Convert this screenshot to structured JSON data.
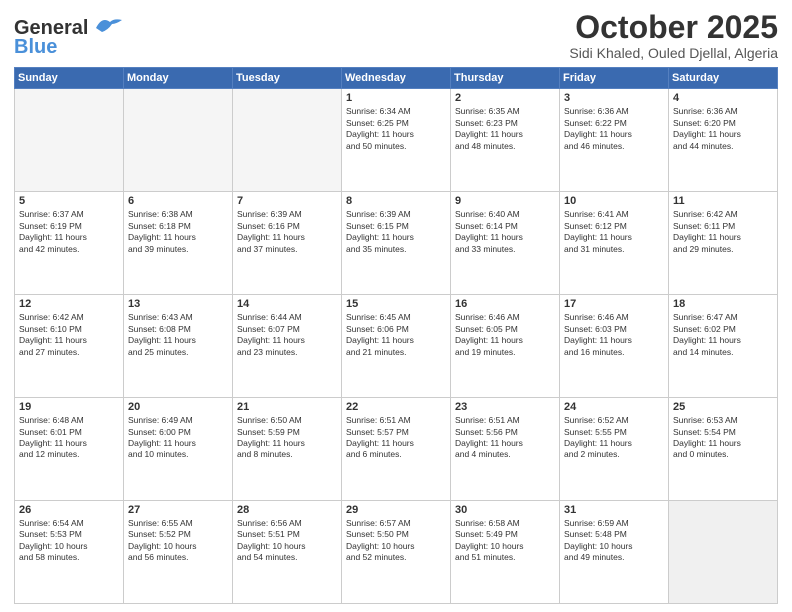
{
  "header": {
    "logo_general": "General",
    "logo_blue": "Blue",
    "month": "October 2025",
    "location": "Sidi Khaled, Ouled Djellal, Algeria"
  },
  "weekdays": [
    "Sunday",
    "Monday",
    "Tuesday",
    "Wednesday",
    "Thursday",
    "Friday",
    "Saturday"
  ],
  "days": [
    {
      "num": "",
      "info": "",
      "empty": true
    },
    {
      "num": "",
      "info": "",
      "empty": true
    },
    {
      "num": "",
      "info": "",
      "empty": true
    },
    {
      "num": "1",
      "info": "Sunrise: 6:34 AM\nSunset: 6:25 PM\nDaylight: 11 hours\nand 50 minutes."
    },
    {
      "num": "2",
      "info": "Sunrise: 6:35 AM\nSunset: 6:23 PM\nDaylight: 11 hours\nand 48 minutes."
    },
    {
      "num": "3",
      "info": "Sunrise: 6:36 AM\nSunset: 6:22 PM\nDaylight: 11 hours\nand 46 minutes."
    },
    {
      "num": "4",
      "info": "Sunrise: 6:36 AM\nSunset: 6:20 PM\nDaylight: 11 hours\nand 44 minutes."
    },
    {
      "num": "5",
      "info": "Sunrise: 6:37 AM\nSunset: 6:19 PM\nDaylight: 11 hours\nand 42 minutes."
    },
    {
      "num": "6",
      "info": "Sunrise: 6:38 AM\nSunset: 6:18 PM\nDaylight: 11 hours\nand 39 minutes."
    },
    {
      "num": "7",
      "info": "Sunrise: 6:39 AM\nSunset: 6:16 PM\nDaylight: 11 hours\nand 37 minutes."
    },
    {
      "num": "8",
      "info": "Sunrise: 6:39 AM\nSunset: 6:15 PM\nDaylight: 11 hours\nand 35 minutes."
    },
    {
      "num": "9",
      "info": "Sunrise: 6:40 AM\nSunset: 6:14 PM\nDaylight: 11 hours\nand 33 minutes."
    },
    {
      "num": "10",
      "info": "Sunrise: 6:41 AM\nSunset: 6:12 PM\nDaylight: 11 hours\nand 31 minutes."
    },
    {
      "num": "11",
      "info": "Sunrise: 6:42 AM\nSunset: 6:11 PM\nDaylight: 11 hours\nand 29 minutes."
    },
    {
      "num": "12",
      "info": "Sunrise: 6:42 AM\nSunset: 6:10 PM\nDaylight: 11 hours\nand 27 minutes."
    },
    {
      "num": "13",
      "info": "Sunrise: 6:43 AM\nSunset: 6:08 PM\nDaylight: 11 hours\nand 25 minutes."
    },
    {
      "num": "14",
      "info": "Sunrise: 6:44 AM\nSunset: 6:07 PM\nDaylight: 11 hours\nand 23 minutes."
    },
    {
      "num": "15",
      "info": "Sunrise: 6:45 AM\nSunset: 6:06 PM\nDaylight: 11 hours\nand 21 minutes."
    },
    {
      "num": "16",
      "info": "Sunrise: 6:46 AM\nSunset: 6:05 PM\nDaylight: 11 hours\nand 19 minutes."
    },
    {
      "num": "17",
      "info": "Sunrise: 6:46 AM\nSunset: 6:03 PM\nDaylight: 11 hours\nand 16 minutes."
    },
    {
      "num": "18",
      "info": "Sunrise: 6:47 AM\nSunset: 6:02 PM\nDaylight: 11 hours\nand 14 minutes."
    },
    {
      "num": "19",
      "info": "Sunrise: 6:48 AM\nSunset: 6:01 PM\nDaylight: 11 hours\nand 12 minutes."
    },
    {
      "num": "20",
      "info": "Sunrise: 6:49 AM\nSunset: 6:00 PM\nDaylight: 11 hours\nand 10 minutes."
    },
    {
      "num": "21",
      "info": "Sunrise: 6:50 AM\nSunset: 5:59 PM\nDaylight: 11 hours\nand 8 minutes."
    },
    {
      "num": "22",
      "info": "Sunrise: 6:51 AM\nSunset: 5:57 PM\nDaylight: 11 hours\nand 6 minutes."
    },
    {
      "num": "23",
      "info": "Sunrise: 6:51 AM\nSunset: 5:56 PM\nDaylight: 11 hours\nand 4 minutes."
    },
    {
      "num": "24",
      "info": "Sunrise: 6:52 AM\nSunset: 5:55 PM\nDaylight: 11 hours\nand 2 minutes."
    },
    {
      "num": "25",
      "info": "Sunrise: 6:53 AM\nSunset: 5:54 PM\nDaylight: 11 hours\nand 0 minutes."
    },
    {
      "num": "26",
      "info": "Sunrise: 6:54 AM\nSunset: 5:53 PM\nDaylight: 10 hours\nand 58 minutes."
    },
    {
      "num": "27",
      "info": "Sunrise: 6:55 AM\nSunset: 5:52 PM\nDaylight: 10 hours\nand 56 minutes."
    },
    {
      "num": "28",
      "info": "Sunrise: 6:56 AM\nSunset: 5:51 PM\nDaylight: 10 hours\nand 54 minutes."
    },
    {
      "num": "29",
      "info": "Sunrise: 6:57 AM\nSunset: 5:50 PM\nDaylight: 10 hours\nand 52 minutes."
    },
    {
      "num": "30",
      "info": "Sunrise: 6:58 AM\nSunset: 5:49 PM\nDaylight: 10 hours\nand 51 minutes."
    },
    {
      "num": "31",
      "info": "Sunrise: 6:59 AM\nSunset: 5:48 PM\nDaylight: 10 hours\nand 49 minutes."
    },
    {
      "num": "",
      "info": "",
      "empty": true
    }
  ]
}
